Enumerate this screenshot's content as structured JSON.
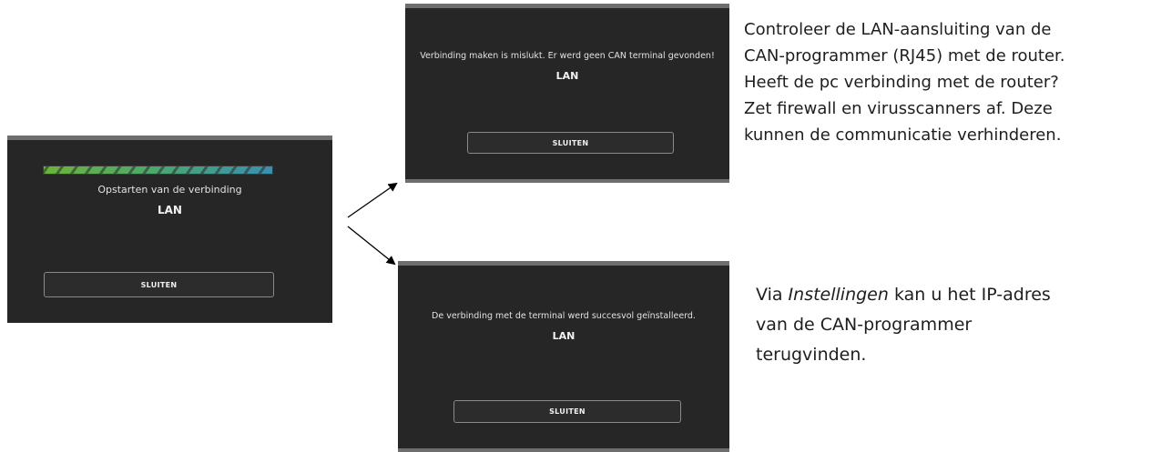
{
  "dialog_progress": {
    "message": "Opstarten van de verbinding",
    "connection": "LAN",
    "close_button": "SLUITEN",
    "progress_percent": 100,
    "progress_colors": [
      "#6bb43a",
      "#4ea96a",
      "#3a8fb0"
    ]
  },
  "dialog_failure": {
    "message": "Verbinding maken is mislukt. Er werd geen CAN terminal gevonden!",
    "connection": "LAN",
    "close_button": "SLUITEN"
  },
  "dialog_success": {
    "message": "De verbinding met de terminal werd succesvol geïnstalleerd.",
    "connection": "LAN",
    "close_button": "SLUITEN"
  },
  "note_failure": {
    "lines": [
      "Controleer de LAN-aansluiting van de",
      "CAN-programmer  (RJ45) met de router.",
      "Heeft de pc verbinding met de router?",
      "Zet firewall en virusscanners af. Deze",
      "kunnen de communicatie  verhinderen."
    ]
  },
  "note_success": {
    "line1_prefix": "Via ",
    "line1_emphasis": "Instellingen",
    "line1_suffix": " kan u het IP-adres",
    "line2": "van de CAN-programmer",
    "line3": "terugvinden."
  },
  "colors": {
    "dialog_background": "#262626",
    "dialog_border_bar": "#6e6e6e",
    "dialog_text": "#e2e2e2",
    "page_background": "#ffffff",
    "arrow": "#000000"
  }
}
